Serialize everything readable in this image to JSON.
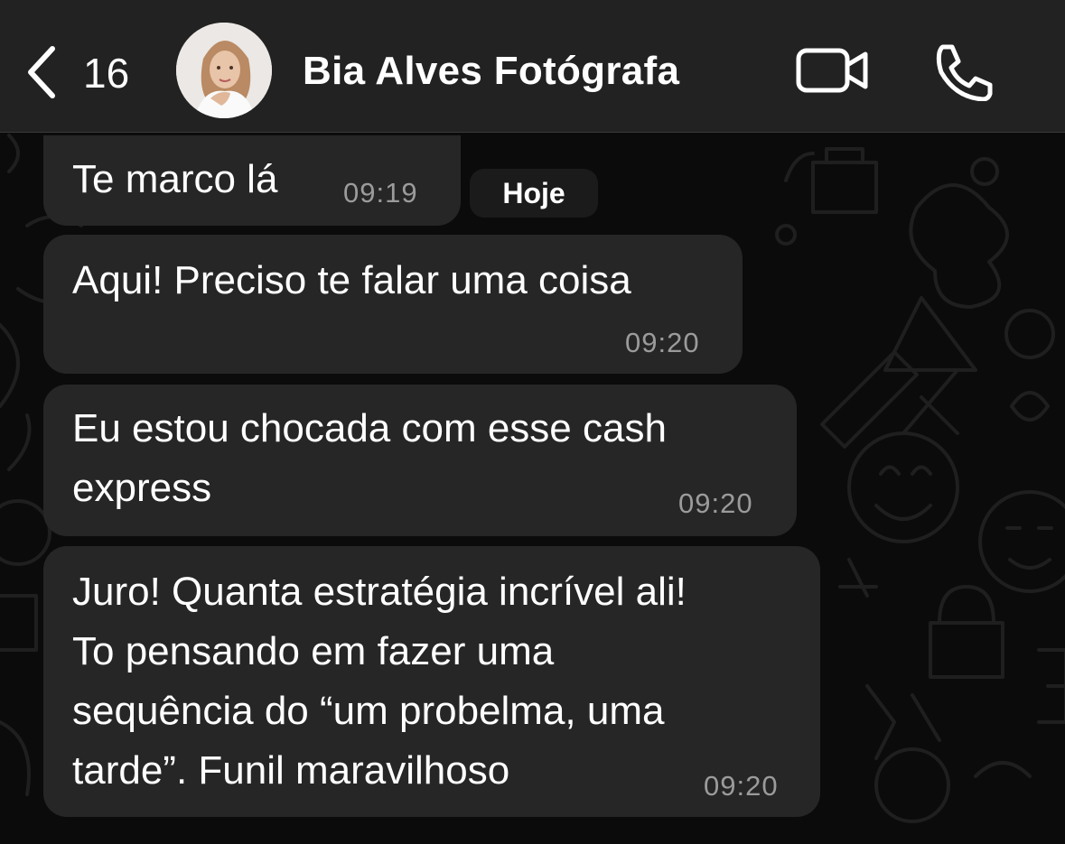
{
  "header": {
    "back_count": "16",
    "contact_name": "Bia Alves Fotógrafa",
    "icons": [
      "chevron-left-icon",
      "video-call-icon",
      "phone-icon"
    ]
  },
  "date_separator": "Hoje",
  "messages": [
    {
      "text": "Te marco lá",
      "time": "09:19"
    },
    {
      "text": "Aqui! Preciso te falar uma coisa",
      "time": "09:20"
    },
    {
      "text": "Eu estou chocada com esse cash\nexpress",
      "time": "09:20"
    },
    {
      "text": "Juro! Quanta estratégia incrível ali!\nTo pensando em fazer uma\nsequência do “um probelma, uma\ntarde”. Funil maravilhoso",
      "time": "09:20"
    }
  ],
  "colors": {
    "background": "#0b0b0b",
    "header": "#222222",
    "bubble": "#262626",
    "text": "#ffffff",
    "timestamp": "#9b9b9b"
  }
}
